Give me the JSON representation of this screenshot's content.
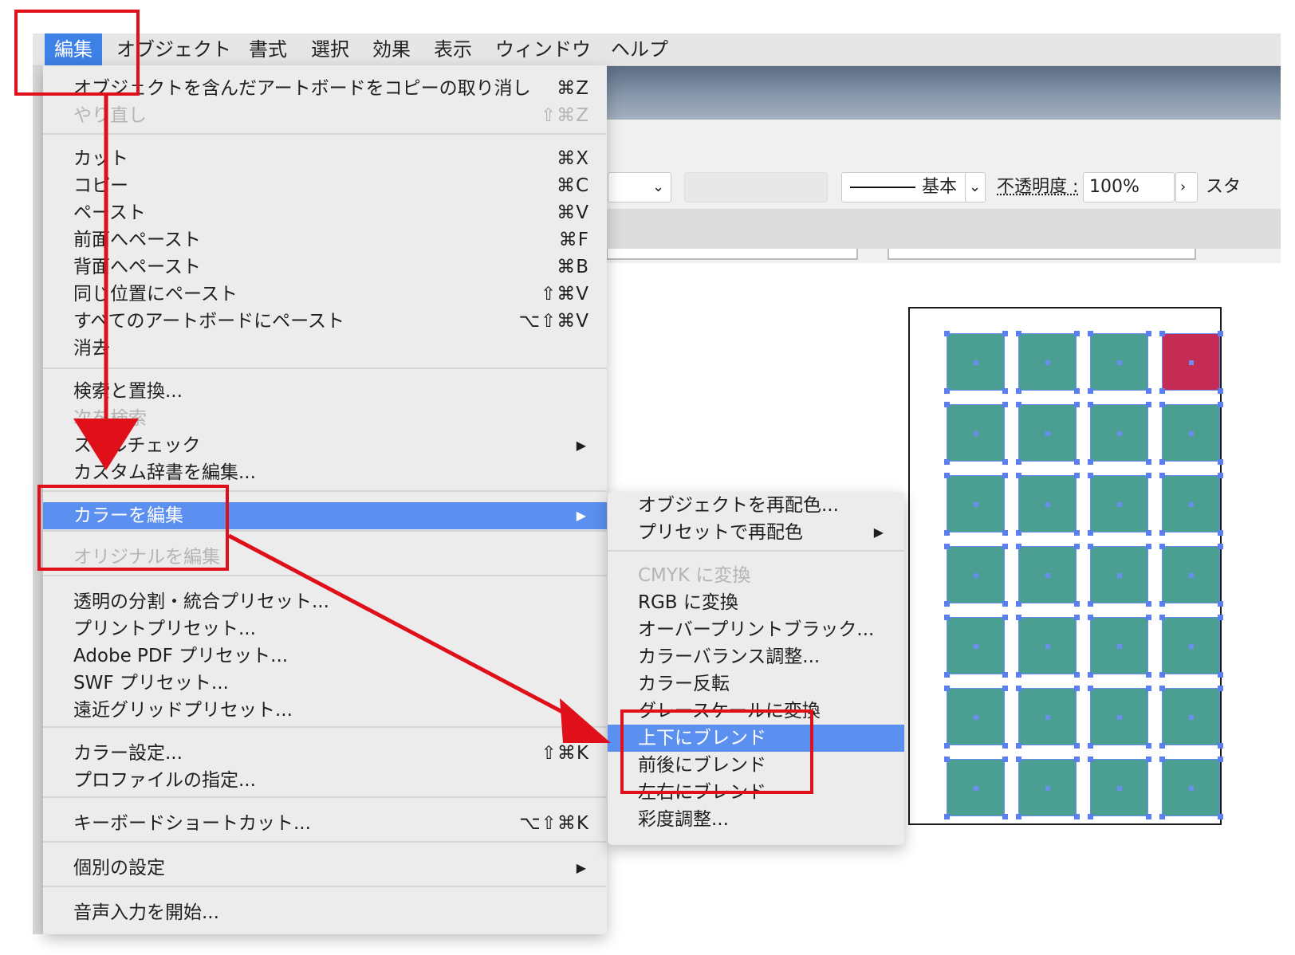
{
  "menubar": {
    "items": [
      "編集",
      "オブジェクト",
      "書式",
      "選択",
      "効果",
      "表示",
      "ウィンドウ",
      "ヘルプ"
    ],
    "active_index": 0
  },
  "controlbar": {
    "stroke_style": "基本",
    "opacity_label": "不透明度 :",
    "opacity_value": "100%",
    "style_label": "スタ"
  },
  "edit_menu": {
    "items": [
      {
        "label": "オブジェクトを含んだアートボードをコピーの取り消し",
        "shortcut": "⌘Z",
        "disabled": false
      },
      {
        "label": "やり直し",
        "shortcut": "⇧⌘Z",
        "disabled": true
      },
      {
        "label": "カット",
        "shortcut": "⌘X",
        "disabled": false
      },
      {
        "label": "コピー",
        "shortcut": "⌘C",
        "disabled": false
      },
      {
        "label": "ペースト",
        "shortcut": "⌘V",
        "disabled": false
      },
      {
        "label": "前面へペースト",
        "shortcut": "⌘F",
        "disabled": false
      },
      {
        "label": "背面へペースト",
        "shortcut": "⌘B",
        "disabled": false
      },
      {
        "label": "同じ位置にペースト",
        "shortcut": "⇧⌘V",
        "disabled": false
      },
      {
        "label": "すべてのアートボードにペースト",
        "shortcut": "⌥⇧⌘V",
        "disabled": false
      },
      {
        "label": "消去",
        "shortcut": "",
        "disabled": false
      },
      {
        "label": "検索と置換...",
        "shortcut": "",
        "disabled": false
      },
      {
        "label": "次を検索",
        "shortcut": "",
        "disabled": true
      },
      {
        "label": "スペルチェック",
        "shortcut": "",
        "disabled": false,
        "submenu": true
      },
      {
        "label": "カスタム辞書を編集...",
        "shortcut": "",
        "disabled": false
      },
      {
        "label": "カラーを編集",
        "shortcut": "",
        "disabled": false,
        "submenu": true,
        "selected": true
      },
      {
        "label": "オリジナルを編集",
        "shortcut": "",
        "disabled": true
      },
      {
        "label": "透明の分割・統合プリセット...",
        "shortcut": "",
        "disabled": false
      },
      {
        "label": "プリントプリセット...",
        "shortcut": "",
        "disabled": false
      },
      {
        "label": "Adobe PDF プリセット...",
        "shortcut": "",
        "disabled": false
      },
      {
        "label": "SWF プリセット...",
        "shortcut": "",
        "disabled": false
      },
      {
        "label": "遠近グリッドプリセット...",
        "shortcut": "",
        "disabled": false
      },
      {
        "label": "カラー設定...",
        "shortcut": "⇧⌘K",
        "disabled": false
      },
      {
        "label": "プロファイルの指定...",
        "shortcut": "",
        "disabled": false
      },
      {
        "label": "キーボードショートカット...",
        "shortcut": "⌥⇧⌘K",
        "disabled": false
      },
      {
        "label": "個別の設定",
        "shortcut": "",
        "disabled": false,
        "submenu": true
      },
      {
        "label": "音声入力を開始...",
        "shortcut": "",
        "disabled": false
      }
    ]
  },
  "color_submenu": {
    "items": [
      {
        "label": "オブジェクトを再配色...",
        "disabled": false
      },
      {
        "label": "プリセットで再配色",
        "disabled": false,
        "submenu": true
      },
      {
        "label": "CMYK に変換",
        "disabled": true
      },
      {
        "label": "RGB に変換",
        "disabled": false
      },
      {
        "label": "オーバープリントブラック...",
        "disabled": false
      },
      {
        "label": "カラーバランス調整...",
        "disabled": false
      },
      {
        "label": "カラー反転",
        "disabled": false
      },
      {
        "label": "グレースケールに変換",
        "disabled": false
      },
      {
        "label": "上下にブレンド",
        "disabled": false,
        "selected": true
      },
      {
        "label": "前後にブレンド",
        "disabled": false
      },
      {
        "label": "左右にブレンド",
        "disabled": false
      },
      {
        "label": "彩度調整...",
        "disabled": false
      }
    ]
  },
  "artboard": {
    "columns": 4,
    "rows": 7,
    "fill_color": "#4a9e92",
    "highlight_color": "#c42b55",
    "highlight_cell": [
      0,
      3
    ],
    "selection_color": "#5b7ff0"
  },
  "annotation_color": "#e0101b"
}
